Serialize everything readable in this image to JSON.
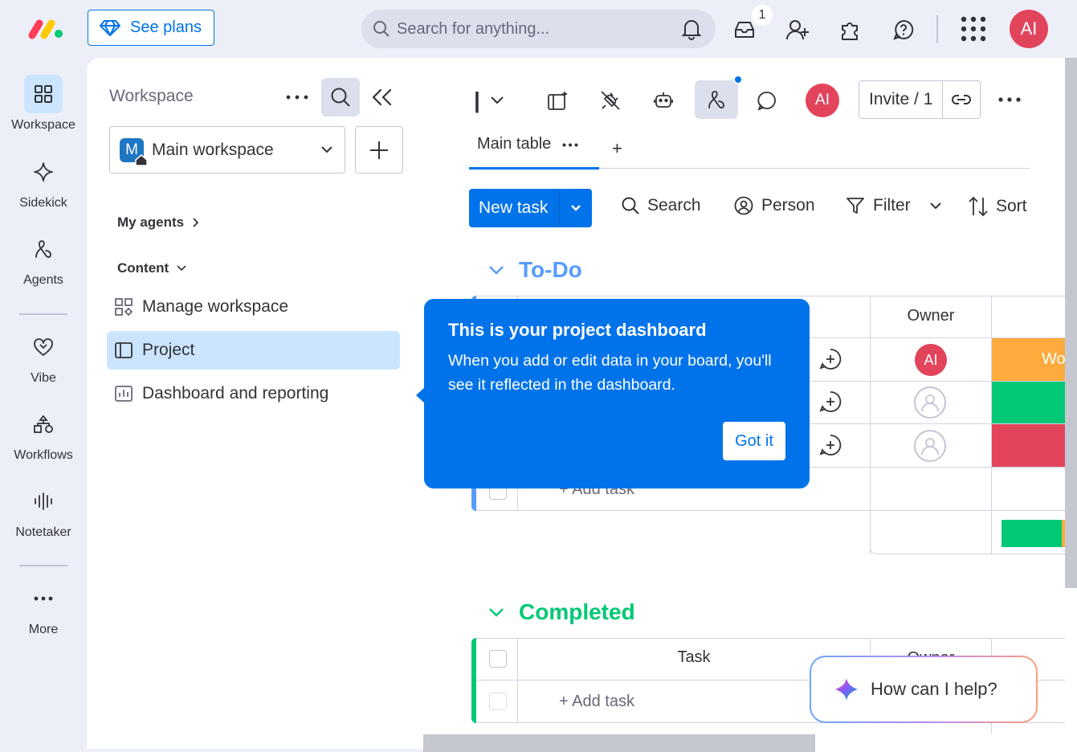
{
  "topbar": {
    "see_plans": "See plans",
    "search_placeholder": "Search for anything...",
    "inbox_count": "1",
    "avatar_initials": "AI"
  },
  "rail": {
    "items": [
      {
        "label": "Workspace",
        "icon": "grid-icon"
      },
      {
        "label": "Sidekick",
        "icon": "sparkle-icon"
      },
      {
        "label": "Agents",
        "icon": "agent-icon"
      },
      {
        "label": "Vibe",
        "icon": "heart-icon"
      },
      {
        "label": "Workflows",
        "icon": "workflow-icon"
      },
      {
        "label": "Notetaker",
        "icon": "waveform-icon"
      },
      {
        "label": "More",
        "icon": "more-dots-icon"
      }
    ]
  },
  "workspace_panel": {
    "title": "Workspace",
    "selected_workspace": "Main workspace",
    "workspace_badge": "M",
    "my_agents": "My agents",
    "content": "Content",
    "items": [
      {
        "label": "Manage workspace",
        "icon": "manage-icon"
      },
      {
        "label": "Project",
        "icon": "board-icon"
      },
      {
        "label": "Dashboard and reporting",
        "icon": "dashboard-icon"
      }
    ]
  },
  "board": {
    "title_cursor": "|",
    "avatar_initials": "AI",
    "invite": "Invite / 1",
    "tabs": [
      {
        "label": "Main table"
      }
    ],
    "add_tab": "+",
    "new_task": "New task",
    "toolbar": {
      "search": "Search",
      "person": "Person",
      "filter": "Filter",
      "sort": "Sort"
    },
    "groups": [
      {
        "name": "To-Do",
        "color": "#579bfc",
        "owner_header": "Owner",
        "add_task": "+ Add task",
        "rows": [
          {
            "owner": "AI",
            "status_text": "Wo",
            "status_color": "#fdab3d"
          },
          {
            "owner": "",
            "status_text": "",
            "status_color": "#00c875"
          },
          {
            "owner": "",
            "status_text": "",
            "status_color": "#e2445c"
          }
        ]
      },
      {
        "name": "Completed",
        "color": "#00c875",
        "task_header": "Task",
        "owner_header": "Owner",
        "add_task": "+ Add task"
      }
    ]
  },
  "tooltip": {
    "title": "This is your project dashboard",
    "body": "When you add or edit data in your board, you'll see it reflected in the dashboard.",
    "button": "Got it"
  },
  "help": {
    "text": "How can I help?"
  },
  "colors": {
    "accent": "#0073ea",
    "brand_red": "#e2445c",
    "todo_blue": "#579bfc",
    "done_green": "#00c875",
    "working_orange": "#fdab3d"
  }
}
